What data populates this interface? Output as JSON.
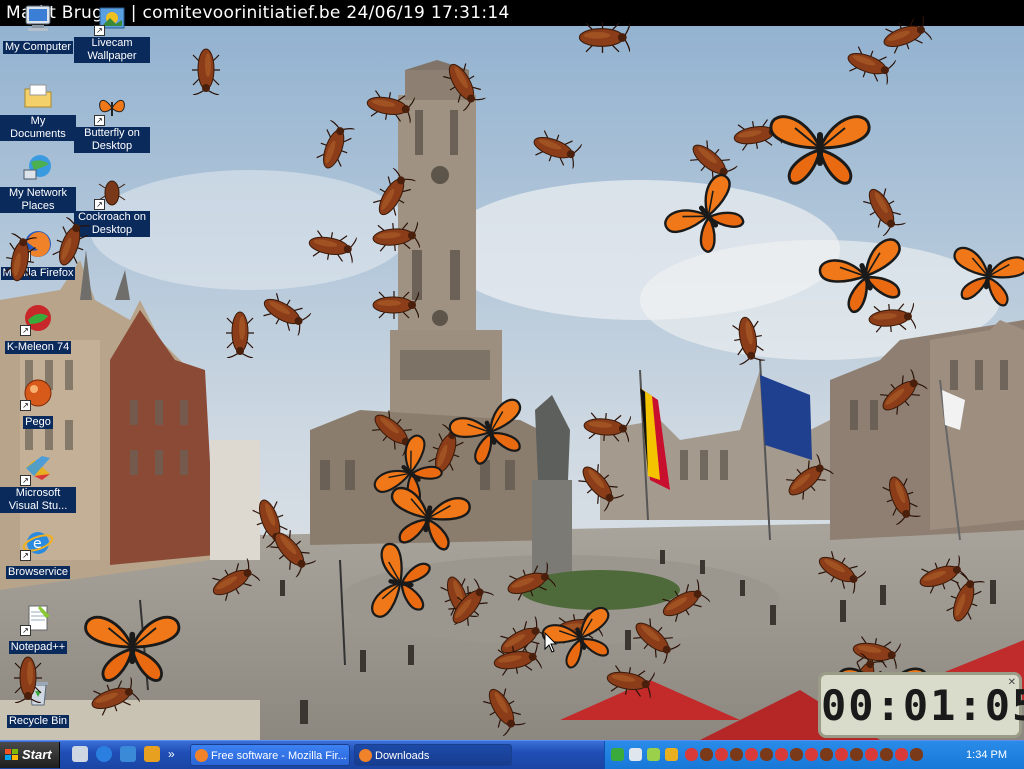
{
  "webcam_caption": "Markt Brugge | comitevoorinitiatief.be 24/06/19 17:31:14",
  "desktop_icons": [
    {
      "label": "My Computer",
      "icon": "my-computer-icon"
    },
    {
      "label": "Livecam Wallpaper",
      "icon": "livecam-icon",
      "shortcut": true
    },
    {
      "label": "My Documents",
      "icon": "my-documents-icon"
    },
    {
      "label": "Butterfly on Desktop",
      "icon": "butterfly-icon",
      "shortcut": true
    },
    {
      "label": "My Network Places",
      "icon": "network-places-icon"
    },
    {
      "label": "Cockroach on Desktop",
      "icon": "cockroach-icon",
      "shortcut": true
    },
    {
      "label": "Mozilla Firefox",
      "icon": "firefox-icon",
      "shortcut": true
    },
    {
      "label": "K-Meleon 74",
      "icon": "k-meleon-icon",
      "shortcut": true
    },
    {
      "label": "Pego",
      "icon": "pego-icon",
      "shortcut": true
    },
    {
      "label": "Microsoft Visual Stu...",
      "icon": "visual-studio-icon",
      "shortcut": true
    },
    {
      "label": "Browservice",
      "icon": "browservice-icon",
      "shortcut": true
    },
    {
      "label": "Notepad++",
      "icon": "notepad-plus-plus-icon",
      "shortcut": true
    },
    {
      "label": "Recycle Bin",
      "icon": "recycle-bin-icon"
    }
  ],
  "clock_widget": {
    "time": "00:01:05"
  },
  "taskbar": {
    "start_label": "Start",
    "quick_launch": [
      "show-desktop-icon",
      "ie-icon",
      "outlook-icon",
      "media-icon"
    ],
    "chevron": "»",
    "tasks": [
      {
        "label": "Free software - Mozilla Fir...",
        "icon": "firefox-icon",
        "active": false
      },
      {
        "label": "Downloads",
        "icon": "downloads-icon",
        "active": true
      }
    ],
    "tray_time": "1:34 PM"
  },
  "colors": {
    "taskbar": "#1f4fb6",
    "tray": "#1778d8",
    "icon_label_bg": "#0b2a5c",
    "butterfly_orange": "#f07818",
    "cockroach_brown": "#7a3a1a"
  }
}
